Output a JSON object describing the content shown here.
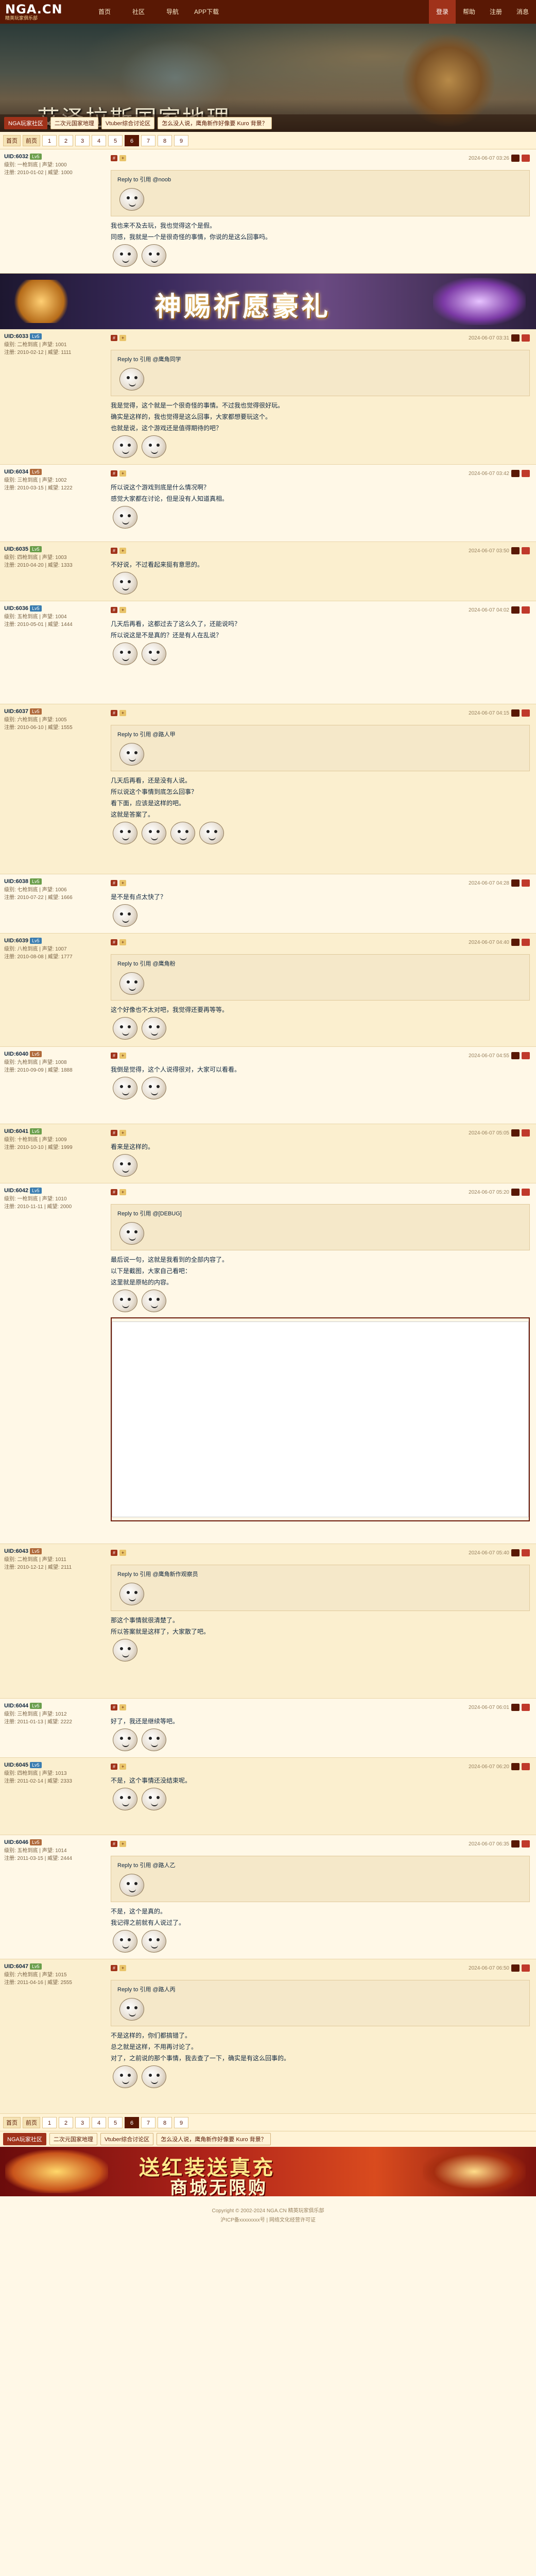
{
  "topbar": {
    "logo_big": "NGA.CN",
    "logo_small": "精英玩家俱乐部",
    "nav": [
      "首页",
      "社区",
      "导航",
      "APP下载"
    ],
    "right": [
      "登录",
      "帮助",
      "注册",
      "消息"
    ]
  },
  "banner": {
    "title": "艾泽拉斯国家地理",
    "crumbs": [
      "NGA玩家社区",
      "二次元国家地理",
      "Vtuber综合讨论区",
      "怎么没人说，鹰角新作好像要 Kuro 背景？"
    ]
  },
  "pager": {
    "labels": [
      "首页",
      "前页"
    ],
    "pages": [
      "1",
      "2",
      "3",
      "4",
      "5",
      "6",
      "7",
      "8",
      "9"
    ],
    "current": "6"
  },
  "ad1": {
    "text": "神赐祈愿豪礼"
  },
  "ad2": {
    "line1": "送红装送真充",
    "line2": "商城无限购"
  },
  "posts": [
    {
      "user": "UID:6032",
      "lv": "Lv5",
      "stat": "级别: 一枪到底 | 声望: 1000\n注册: 2010-01-02 | 威望: 1000",
      "time": "2024-06-07 03:26",
      "q": "Reply to 引用 @noob",
      "lines": [
        "我也来不及去玩，我也觉得这个是假。",
        "同感，我就是一个是很奇怪的事情，你说的是这么回事吗。"
      ]
    },
    {
      "user": "UID:6033",
      "lv": "Lv5",
      "stat": "级别: 二枪到底 | 声望: 1001\n注册: 2010-02-12 | 威望: 1111",
      "time": "2024-06-07 03:31",
      "q": "Reply to 引用 @鹰角同学",
      "lines": [
        "我是觉得，这个就是一个很奇怪的事情。不过我也觉得很好玩。",
        "确实是这样的，我也觉得是这么回事，大家都想要玩这个。",
        "也就是说，这个游戏还是值得期待的吧？"
      ]
    },
    {
      "user": "UID:6034",
      "lv": "Lv5",
      "stat": "级别: 三枪到底 | 声望: 1002\n注册: 2010-03-15 | 威望: 1222",
      "time": "2024-06-07 03:42",
      "q": "",
      "lines": [
        "所以说这个游戏到底是什么情况啊？",
        "感觉大家都在讨论，但是没有人知道真相。"
      ]
    },
    {
      "user": "UID:6035",
      "lv": "Lv5",
      "stat": "级别: 四枪到底 | 声望: 1003\n注册: 2010-04-20 | 威望: 1333",
      "time": "2024-06-07 03:50",
      "q": "",
      "lines": [
        "不好说，不过看起来挺有意思的。"
      ]
    },
    {
      "user": "UID:6036",
      "lv": "Lv5",
      "stat": "级别: 五枪到底 | 声望: 1004\n注册: 2010-05-01 | 威望: 1444",
      "time": "2024-06-07 04:02",
      "q": "",
      "lines": [
        "几天后再看，这都过去了这么久了，还能说吗？",
        "所以说这是不是真的？还是有人在乱说？"
      ]
    },
    {
      "user": "UID:6037",
      "lv": "Lv5",
      "stat": "级别: 六枪到底 | 声望: 1005\n注册: 2010-06-10 | 威望: 1555",
      "time": "2024-06-07 04:15",
      "q": "Reply to 引用 @路人甲",
      "lines": [
        "几天后再看，还是没有人说。",
        "所以说这个事情到底怎么回事？",
        "看下面，应该是这样的吧。",
        "这就是答案了。"
      ]
    },
    {
      "user": "UID:6038",
      "lv": "Lv5",
      "stat": "级别: 七枪到底 | 声望: 1006\n注册: 2010-07-22 | 威望: 1666",
      "time": "2024-06-07 04:28",
      "q": "",
      "lines": [
        "是不是有点太快了？"
      ]
    },
    {
      "user": "UID:6039",
      "lv": "Lv5",
      "stat": "级别: 八枪到底 | 声望: 1007\n注册: 2010-08-08 | 威望: 1777",
      "time": "2024-06-07 04:40",
      "q": "Reply to 引用 @鹰角粉",
      "lines": [
        "这个好像也不太对吧，我觉得还要再等等。"
      ]
    },
    {
      "user": "UID:6040",
      "lv": "Lv5",
      "stat": "级别: 九枪到底 | 声望: 1008\n注册: 2010-09-09 | 威望: 1888",
      "time": "2024-06-07 04:55",
      "q": "",
      "lines": [
        "我倒是觉得，这个人说得很对，大家可以看看。"
      ]
    },
    {
      "user": "UID:6041",
      "lv": "Lv5",
      "stat": "级别: 十枪到底 | 声望: 1009\n注册: 2010-10-10 | 威望: 1999",
      "time": "2024-06-07 05:05",
      "q": "",
      "lines": [
        "看来是这样的。"
      ]
    },
    {
      "user": "UID:6042",
      "lv": "Lv5",
      "stat": "级别: 一枪到底 | 声望: 1010\n注册: 2010-11-11 | 威望: 2000",
      "time": "2024-06-07 05:20",
      "q": "Reply to 引用 @[DEBUG]",
      "lines": [
        "最后说一句，这就是我看到的全部内容了。",
        "以下是截图，大家自己看吧：",
        "这里就是原帖的内容。"
      ]
    },
    {
      "user": "UID:6043",
      "lv": "Lv5",
      "stat": "级别: 二枪到底 | 声望: 1011\n注册: 2010-12-12 | 威望: 2111",
      "time": "2024-06-07 05:40",
      "q": "Reply to 引用 @鹰角新作观察员",
      "lines": [
        "那这个事情就很清楚了。",
        "所以答案就是这样了，大家散了吧。"
      ]
    },
    {
      "user": "UID:6044",
      "lv": "Lv5",
      "stat": "级别: 三枪到底 | 声望: 1012\n注册: 2011-01-13 | 威望: 2222",
      "time": "2024-06-07 06:01",
      "q": "",
      "lines": [
        "好了，我还是继续等吧。"
      ]
    },
    {
      "user": "UID:6045",
      "lv": "Lv5",
      "stat": "级别: 四枪到底 | 声望: 1013\n注册: 2011-02-14 | 威望: 2333",
      "time": "2024-06-07 06:20",
      "q": "",
      "lines": [
        "不是，这个事情还没结束呢。"
      ]
    },
    {
      "user": "UID:6046",
      "lv": "Lv5",
      "stat": "级别: 五枪到底 | 声望: 1014\n注册: 2011-03-15 | 威望: 2444",
      "time": "2024-06-07 06:35",
      "q": "Reply to 引用 @路人乙",
      "lines": [
        "不是，这个是真的。",
        "我记得之前就有人说过了。"
      ]
    },
    {
      "user": "UID:6047",
      "lv": "Lv5",
      "stat": "级别: 六枪到底 | 声望: 1015\n注册: 2011-04-16 | 威望: 2555",
      "time": "2024-06-07 06:50",
      "q": "Reply to 引用 @路人丙",
      "lines": [
        "不是这样的，你们都搞错了。",
        "总之就是这样，不用再讨论了。",
        "对了，之前说的那个事情，我去查了一下，确实是有这么回事的。"
      ]
    }
  ],
  "footer": {
    "line1": "Copyright © 2002-2024 NGA.CN 精英玩家俱乐部",
    "line2": "沪ICP备xxxxxxxx号 | 网络文化经营许可证"
  }
}
